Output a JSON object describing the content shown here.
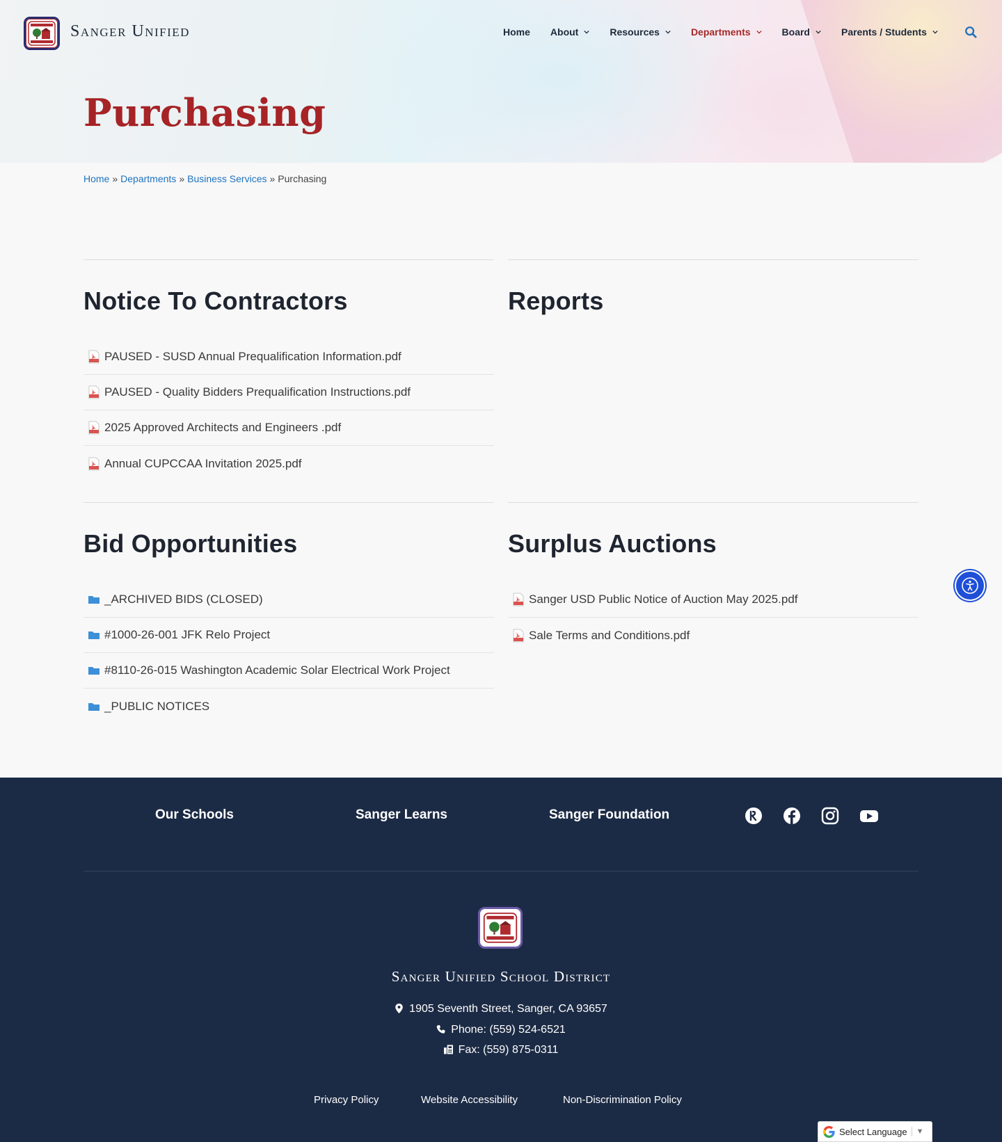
{
  "header": {
    "site_title": "Sanger Unified",
    "nav": [
      {
        "label": "Home",
        "has_dropdown": false
      },
      {
        "label": "About",
        "has_dropdown": true
      },
      {
        "label": "Resources",
        "has_dropdown": true
      },
      {
        "label": "Departments",
        "has_dropdown": true,
        "active": true
      },
      {
        "label": "Board",
        "has_dropdown": true
      },
      {
        "label": "Parents / Students",
        "has_dropdown": true
      }
    ],
    "search_icon": "search-icon"
  },
  "page": {
    "title": "Purchasing",
    "breadcrumb": {
      "items": [
        "Home",
        "Departments",
        "Business Services"
      ],
      "current": "Purchasing",
      "separator": "»"
    }
  },
  "sections": {
    "notice": {
      "title": "Notice To Contractors",
      "items": [
        "PAUSED - SUSD Annual Prequalification Information.pdf",
        "PAUSED - Quality Bidders Prequalification Instructions.pdf",
        "2025 Approved Architects and Engineers .pdf",
        "Annual CUPCCAA Invitation 2025.pdf"
      ]
    },
    "reports": {
      "title": "Reports",
      "items": []
    },
    "bids": {
      "title": "Bid Opportunities",
      "items": [
        "_ARCHIVED BIDS (CLOSED)",
        "#1000-26-001 JFK Relo Project",
        "#8110-26-015 Washington Academic Solar Electrical Work Project",
        "_PUBLIC NOTICES"
      ]
    },
    "surplus": {
      "title": "Surplus Auctions",
      "items": [
        "Sanger USD Public Notice of Auction May 2025.pdf",
        "Sale Terms and Conditions.pdf"
      ]
    }
  },
  "footer": {
    "links": [
      "Our Schools",
      "Sanger Learns",
      "Sanger Foundation"
    ],
    "social_icons": [
      "rooms-icon",
      "facebook-icon",
      "instagram-icon",
      "youtube-icon"
    ],
    "district_name": "Sanger Unified School District",
    "address": "1905 Seventh Street, Sanger, CA 93657",
    "phone": "Phone: (559) 524-6521",
    "fax": "Fax: (559) 875-0311",
    "legal": [
      "Privacy Policy",
      "Website Accessibility",
      "Non-Discrimination Policy"
    ]
  },
  "translate": {
    "label": "Select Language",
    "arrow": "▼"
  },
  "colors": {
    "accent": "#a62326",
    "link": "#1e73be",
    "footer_bg": "#1c2b45",
    "a11y": "#1f4fd8"
  }
}
